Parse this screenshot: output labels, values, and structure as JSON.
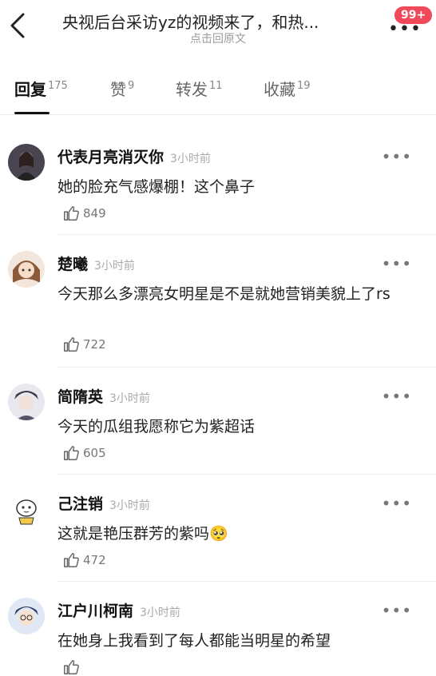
{
  "header": {
    "title": "央视后台采访yz的视频来了，和热...",
    "subtitle": "点击回原文",
    "badge": "99+",
    "more": "•••"
  },
  "tabs": [
    {
      "label": "回复",
      "count": "175"
    },
    {
      "label": "赞",
      "count": "9"
    },
    {
      "label": "转发",
      "count": "11"
    },
    {
      "label": "收藏",
      "count": "19"
    }
  ],
  "comments": [
    {
      "name": "代表月亮消灭你",
      "time": "3小时前",
      "text": "她的脸充气感爆棚！这个鼻子",
      "likes": "849"
    },
    {
      "name": "楚曦",
      "time": "3小时前",
      "text": "今天那么多漂亮女明星是不是就她营销美貌上了rs",
      "likes": "722"
    },
    {
      "name": "简隋英",
      "time": "3小时前",
      "text": "今天的瓜组我愿称它为紫超话",
      "likes": "605"
    },
    {
      "name": "己注销",
      "time": "3小时前",
      "text": "这就是艳压群芳的紫吗",
      "emoji": "🥺",
      "likes": "472"
    },
    {
      "name": "江户川柯南",
      "time": "3小时前",
      "text": "在她身上我看到了每人都能当明星的希望",
      "likes": ""
    }
  ],
  "icons": {
    "back": "chevron-left-icon",
    "like": "thumbs-up-icon",
    "more": "more-dots-icon"
  }
}
